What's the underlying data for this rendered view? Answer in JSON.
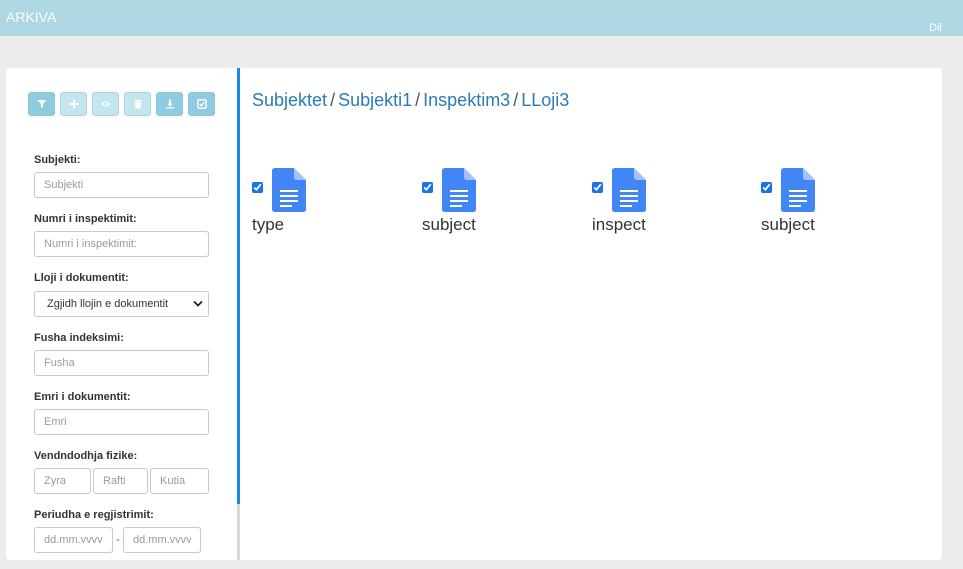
{
  "header": {
    "app_title": "ARKIVA",
    "lang_label": "Dil",
    "bar_color": "#acd7e3"
  },
  "toolbar": {
    "buttons": [
      {
        "name": "filter",
        "icon": "filter-icon"
      },
      {
        "name": "add",
        "icon": "plus-icon"
      },
      {
        "name": "view",
        "icon": "eye-icon"
      },
      {
        "name": "delete",
        "icon": "trash-icon"
      },
      {
        "name": "download",
        "icon": "download-icon"
      },
      {
        "name": "check",
        "icon": "check-square-icon"
      }
    ]
  },
  "filters": {
    "subject": {
      "label": "Subjekti:",
      "placeholder": "Subjekti",
      "value": ""
    },
    "inspection_number": {
      "label": "Numri i inspektimit:",
      "placeholder": "Numri i inspektimit:",
      "value": ""
    },
    "document_type": {
      "label": "Lloji i dokumentit:",
      "selected": "Zgjidh llojin e dokumentit"
    },
    "index_field": {
      "label": "Fusha indeksimi:",
      "placeholder": "Fusha",
      "value": ""
    },
    "document_name": {
      "label": "Emri i dokumentit:",
      "placeholder": "Emri",
      "value": ""
    },
    "physical_location": {
      "label": "Vendndodhja fizike:",
      "office_placeholder": "Zyra",
      "shelf_placeholder": "Rafti",
      "box_placeholder": "Kutia"
    },
    "registration_period": {
      "label": "Periudha e regjistrimit:",
      "from_placeholder": "dd.mm.vvvv",
      "separator": "-",
      "to_placeholder": "dd.mm.vvvv"
    }
  },
  "breadcrumb": {
    "items": [
      "Subjektet",
      "Subjekti1",
      "Inspektim3",
      "LLoji3"
    ],
    "separator": "/",
    "link_color": "#2a7ab8"
  },
  "files": [
    {
      "name": "type",
      "checked": true,
      "icon": "document-icon"
    },
    {
      "name": "subject",
      "checked": true,
      "icon": "document-icon"
    },
    {
      "name": "inspect",
      "checked": true,
      "icon": "document-icon"
    },
    {
      "name": "subject",
      "checked": true,
      "icon": "document-icon"
    }
  ],
  "colors": {
    "accent": "#1a8be0",
    "doc_icon": "#4285f4"
  }
}
